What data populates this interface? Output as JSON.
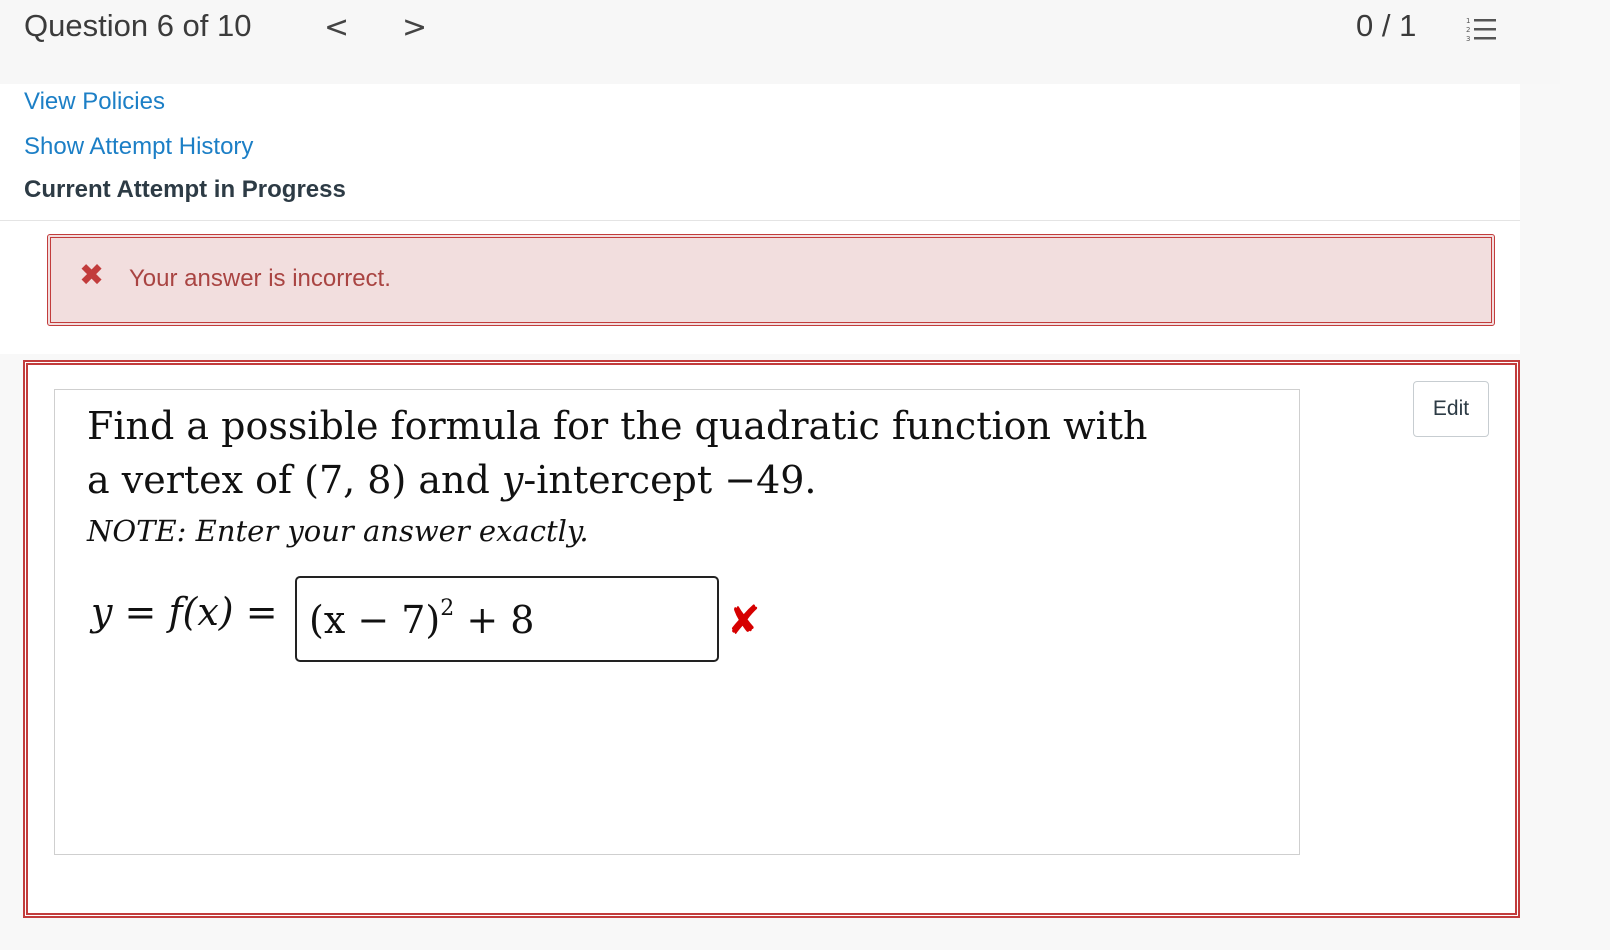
{
  "header": {
    "question_label": "Question 6 of 10",
    "prev_icon": "<",
    "next_icon": ">",
    "score": "0 / 1",
    "list_icon": "numbered-list-icon"
  },
  "links": {
    "view_policies": "View Policies",
    "show_attempt_history": "Show Attempt History",
    "current_attempt": "Current Attempt in Progress"
  },
  "alert": {
    "icon": "✖",
    "message": "Your answer is incorrect."
  },
  "question": {
    "line1": "Find a possible formula for the quadratic function with",
    "line2_prefix": "a vertex of (7, 8) and ",
    "line2_var": "y",
    "line2_suffix": "-intercept −49.",
    "note": "NOTE: Enter your answer exactly.",
    "answer_label": "y = f(x) =",
    "answer_base": "(x − 7)",
    "answer_exponent": "2",
    "answer_rest": " + 8",
    "result_mark": "✘",
    "edit_label": "Edit"
  },
  "colors": {
    "accent_link": "#1c7fc6",
    "error_border": "#c23c3c",
    "error_bg": "#f2dede",
    "error_text": "#a94442",
    "wrong_mark": "#d60000"
  }
}
